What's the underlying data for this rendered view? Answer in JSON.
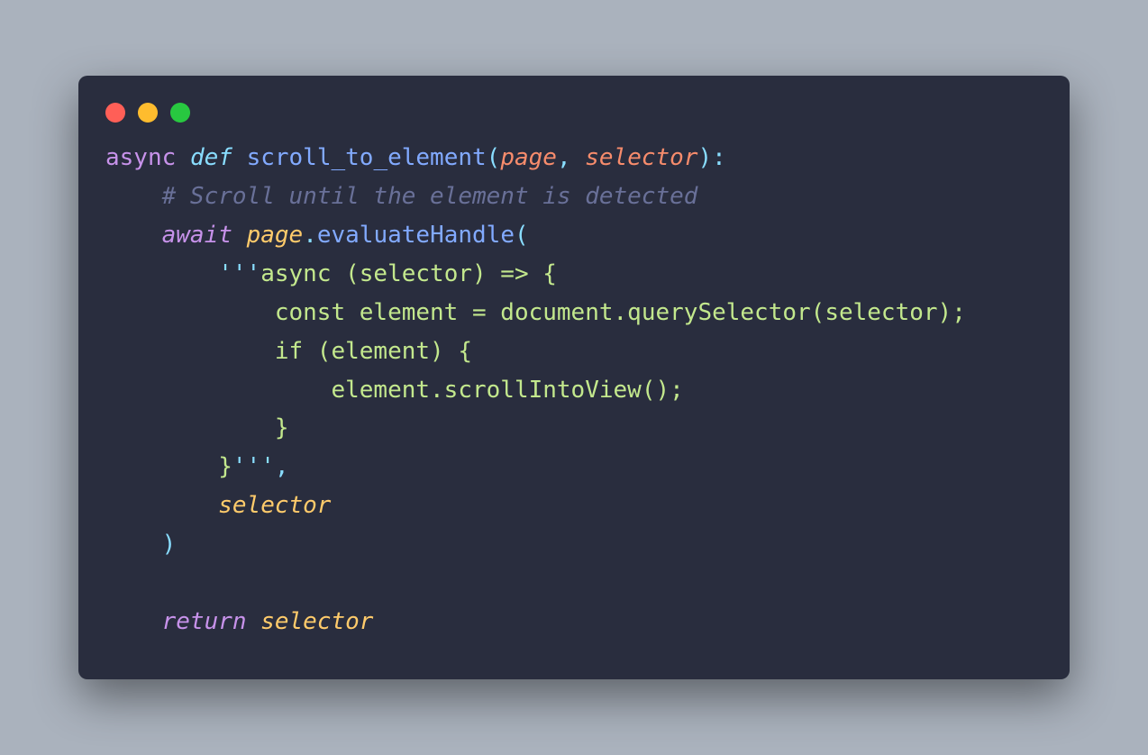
{
  "code": {
    "kw_async": "async",
    "kw_def": "def",
    "fn_name": "scroll_to_element",
    "paren_open": "(",
    "param_page": "page",
    "comma_space": ", ",
    "param_selector": "selector",
    "paren_close_colon": "):",
    "comment": "# Scroll until the element is detected",
    "kw_await": "await",
    "obj_page": "page",
    "dot": ".",
    "method": "evaluateHandle",
    "open_paren": "(",
    "str_open": "'''",
    "str_l1": "async (selector) => {",
    "str_l2": "            const element = document.querySelector(selector);",
    "str_l3": "            if (element) {",
    "str_l4": "                element.scrollIntoView();",
    "str_l5": "            }",
    "str_l6": "        }",
    "str_close": "'''",
    "comma": ",",
    "arg_selector": "selector",
    "close_paren": ")",
    "kw_return": "return",
    "ret_val": "selector"
  }
}
